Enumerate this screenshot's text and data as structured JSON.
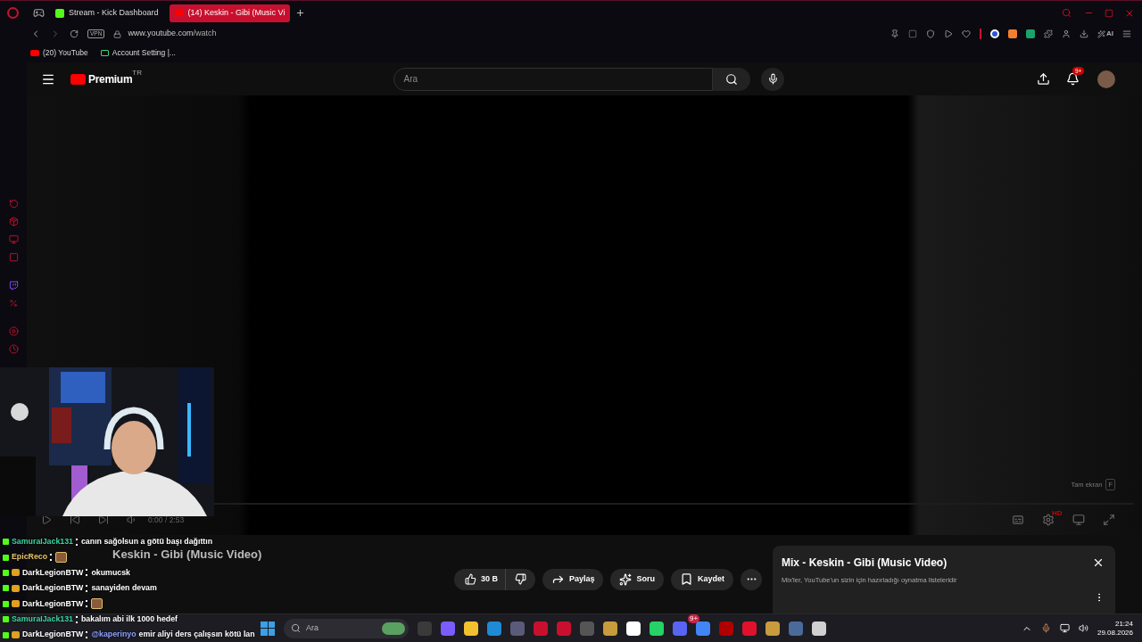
{
  "browser": {
    "tabs": [
      {
        "label": "Stream - Kick Dashboard",
        "selected": false,
        "kind": "kick"
      },
      {
        "label": "(14) Keskin - Gibi (Music Vi",
        "selected": true,
        "kind": "youtube"
      }
    ],
    "vpn": "VPN",
    "url_host": "www.youtube.com",
    "url_path": "/watch",
    "ai": "AI",
    "bookmarks": [
      {
        "label": "(20) YouTube",
        "kind": "youtube"
      },
      {
        "label": "Account Setting |...",
        "kind": "account"
      }
    ]
  },
  "youtube": {
    "logo": "Premium",
    "region": "TR",
    "search": {
      "placeholder": "Ara"
    },
    "notifications": "9+"
  },
  "player": {
    "time": "0:00 / 2:53",
    "fullscreen_tooltip": "Tam ekran",
    "fullscreen_key": "F",
    "quality_badge": "HD"
  },
  "video": {
    "title": "Keskin - Gibi (Music Video)",
    "likes": "30 B",
    "actions": [
      {
        "label": "Paylaş",
        "kind": "share"
      },
      {
        "label": "Soru",
        "kind": "ask"
      },
      {
        "label": "Kaydet",
        "kind": "save"
      }
    ]
  },
  "mix": {
    "title": "Mix - Keskin - Gibi (Music Video)",
    "subtitle": "Mix'ler, YouTube'un sizin için hazırladığı oynatma listeleridir"
  },
  "chat": [
    {
      "user": "SamuraIJack131",
      "color": "#3ad6a0",
      "crown": false,
      "message": "canın sağolsun a götü başı dağıttın"
    },
    {
      "user": "EpicReco",
      "color": "#e8c56a",
      "crown": false,
      "emote": true
    },
    {
      "user": "DarkLegionBTW",
      "color": "#ffffff",
      "crown": true,
      "message": "okumucsk"
    },
    {
      "user": "DarkLegionBTW",
      "color": "#ffffff",
      "crown": true,
      "message": "sanayiden devam"
    },
    {
      "user": "DarkLegionBTW",
      "color": "#ffffff",
      "crown": true,
      "emote": true
    },
    {
      "user": "SamuraIJack131",
      "color": "#3ad6a0",
      "crown": false,
      "message": "bakalım abi ilk 1000 hedef"
    },
    {
      "user": "DarkLegionBTW",
      "color": "#ffffff",
      "crown": true,
      "mention": "@kaperinyo",
      "message": "emir aliyi ders çalışsın kötü lan"
    }
  ],
  "taskbar": {
    "search": {
      "placeholder": "Ara"
    },
    "app_badge": "9+",
    "time": "21:24",
    "date": "29.08.2026"
  }
}
